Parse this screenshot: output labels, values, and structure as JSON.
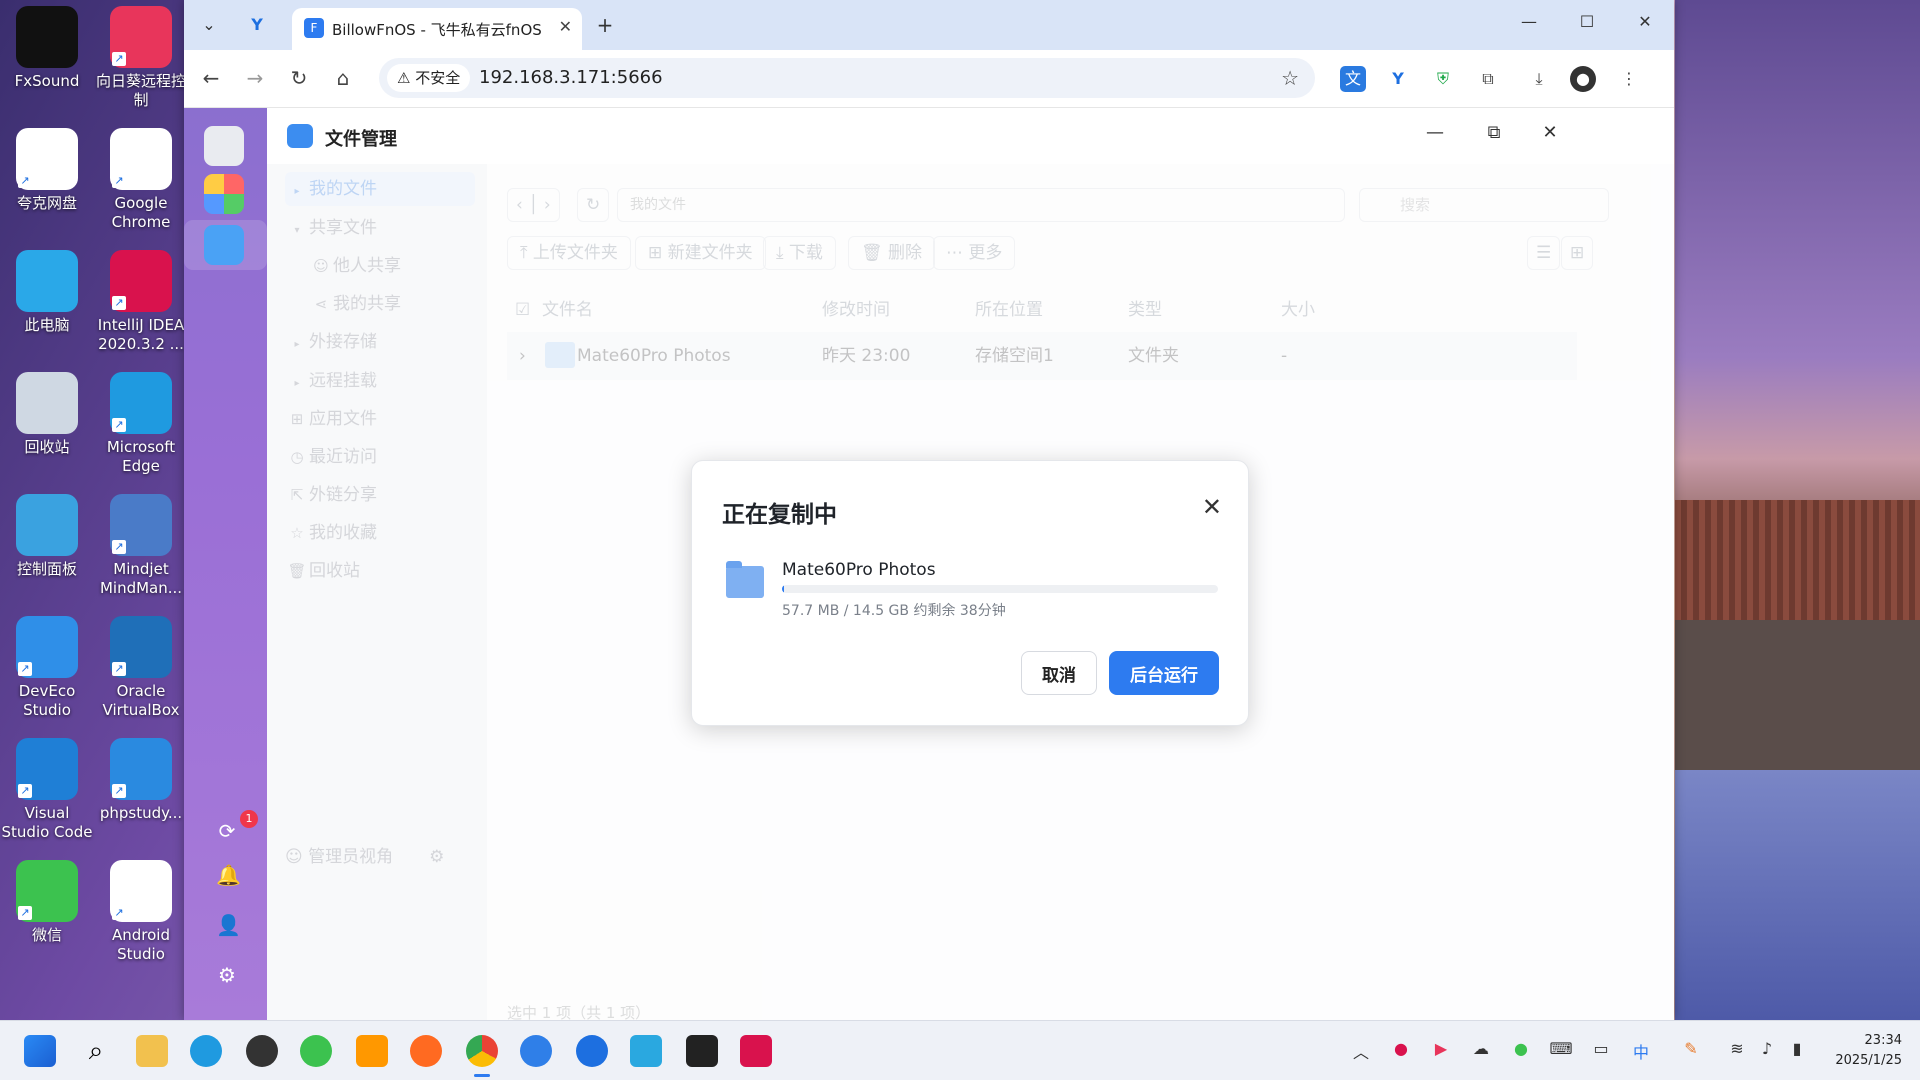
{
  "desktop": {
    "icons": [
      {
        "label": "FxSound",
        "color": "#111111"
      },
      {
        "label": "向日葵远程控制",
        "color": "#e8355b"
      },
      {
        "label": "夸克网盘",
        "color": "#ffffff"
      },
      {
        "label": "Google Chrome",
        "color": "#ffffff"
      },
      {
        "label": "此电脑",
        "color": "#2aa8e8"
      },
      {
        "label": "IntelliJ IDEA 2020.3.2 ...",
        "color": "#d9124d"
      },
      {
        "label": "回收站",
        "color": "#cfd8e3"
      },
      {
        "label": "Microsoft Edge",
        "color": "#1f9ae0"
      },
      {
        "label": "控制面板",
        "color": "#3aa2e0"
      },
      {
        "label": "Mindjet MindMan...",
        "color": "#4a7bc8"
      },
      {
        "label": "DevEco Studio",
        "color": "#2f8fe8"
      },
      {
        "label": "Oracle VirtualBox",
        "color": "#1f6fb8"
      },
      {
        "label": "Visual Studio Code",
        "color": "#1f7fd6"
      },
      {
        "label": "phpstudy...",
        "color": "#2a8ae0"
      },
      {
        "label": "微信",
        "color": "#3cc24f"
      },
      {
        "label": "Android Studio",
        "color": "#ffffff"
      }
    ]
  },
  "browser": {
    "tab_title": "BillowFnOS - 飞牛私有云fnOS",
    "insecure_label": "不安全",
    "url": "192.168.3.171:5666"
  },
  "app": {
    "title": "文件管理",
    "sidebar": {
      "items": [
        {
          "label": "我的文件"
        },
        {
          "label": "共享文件"
        },
        {
          "label": "他人共享"
        },
        {
          "label": "我的共享"
        },
        {
          "label": "外接存储"
        },
        {
          "label": "远程挂载"
        },
        {
          "label": "应用文件"
        },
        {
          "label": "最近访问"
        },
        {
          "label": "外链分享"
        },
        {
          "label": "我的收藏"
        },
        {
          "label": "回收站"
        }
      ],
      "footer": "管理员视角"
    },
    "path_placeholder": "我的文件",
    "search_placeholder": "搜索",
    "toolbar": {
      "upload": "上传文件夹",
      "new_folder": "新建文件夹",
      "download": "下载",
      "delete": "删除",
      "more": "更多"
    },
    "table": {
      "headers": {
        "name": "文件名",
        "modified": "修改时间",
        "location": "所在位置",
        "type": "类型",
        "size": "大小"
      },
      "rows": [
        {
          "name": "Mate60Pro Photos",
          "modified": "昨天 23:00",
          "location": "存储空间1",
          "type": "文件夹",
          "size": "-"
        }
      ]
    },
    "status": "选中 1 项（共 1 项）",
    "notification_count": "1"
  },
  "dialog": {
    "title": "正在复制中",
    "file_name": "Mate60Pro Photos",
    "progress_text": "57.7 MB / 14.5 GB 约剩余 38分钟",
    "progress_fraction": 0.004,
    "cancel_label": "取消",
    "background_label": "后台运行"
  },
  "taskbar": {
    "time": "23:34",
    "date": "2025/1/25"
  }
}
